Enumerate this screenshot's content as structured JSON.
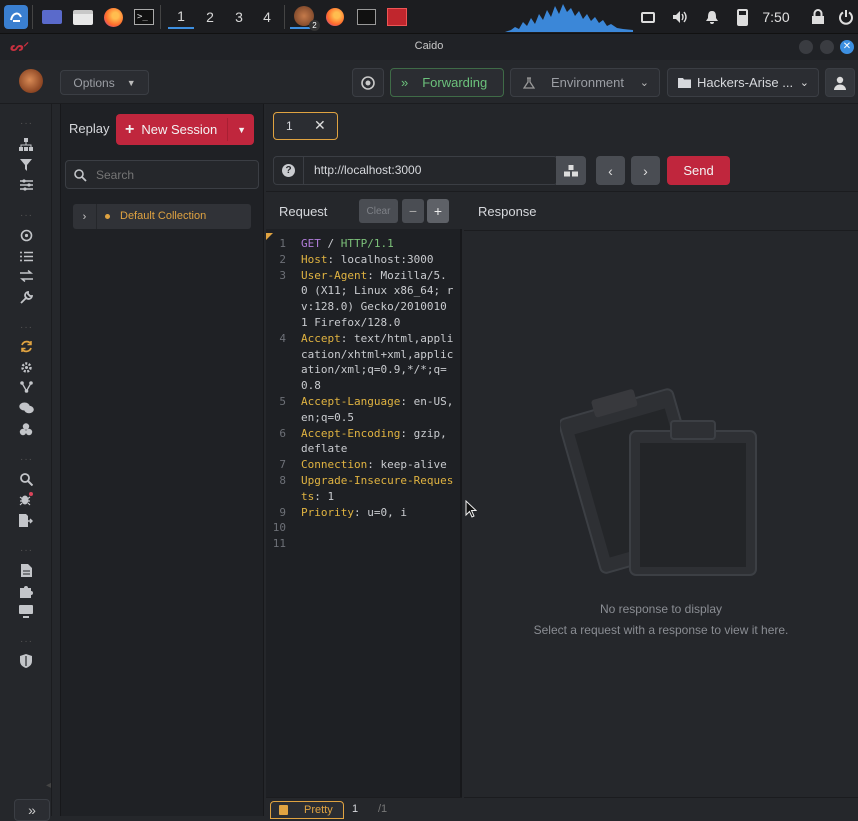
{
  "taskbar": {
    "workspaces": [
      "1",
      "2",
      "3",
      "4"
    ],
    "clock": "7:50",
    "app_badge": "2"
  },
  "app": {
    "title": "Caido"
  },
  "toolbar": {
    "options_label": "Options",
    "forwarding_label": "Forwarding",
    "environment_label": "Environment",
    "project_label": "Hackers-Arise ..."
  },
  "sidebar": {
    "title": "Replay",
    "new_session_label": "New Session",
    "search_placeholder": "Search",
    "collections": [
      {
        "label": "Default Collection"
      }
    ]
  },
  "tabs": [
    {
      "label": "1"
    }
  ],
  "request_bar": {
    "url": "http://localhost:3000",
    "send_label": "Send"
  },
  "request": {
    "title": "Request",
    "clear_label": "Clear",
    "lines": [
      {
        "n": "1",
        "parts": [
          {
            "t": "GET",
            "c": "m"
          },
          {
            "t": " / ",
            "c": ""
          },
          {
            "t": "HTTP/1.1",
            "c": "g"
          }
        ]
      },
      {
        "n": "2",
        "parts": [
          {
            "t": "Host",
            "c": "k"
          },
          {
            "t": ": localhost:3000",
            "c": ""
          }
        ]
      },
      {
        "n": "3",
        "parts": [
          {
            "t": "User-Agent",
            "c": "k"
          },
          {
            "t": ": Mozilla/5.\n0 (X11; Linux x86_64; r\nv:128.0) Gecko/2010010\n1 Firefox/128.0",
            "c": ""
          }
        ]
      },
      {
        "n": "4",
        "parts": [
          {
            "t": "Accept",
            "c": "k"
          },
          {
            "t": ": text/html,appli\ncation/xhtml+xml,applic\nation/xml;q=0.9,*/*;q=\n0.8",
            "c": ""
          }
        ]
      },
      {
        "n": "5",
        "parts": [
          {
            "t": "Accept-Language",
            "c": "k"
          },
          {
            "t": ": en-US,\nen;q=0.5",
            "c": ""
          }
        ]
      },
      {
        "n": "6",
        "parts": [
          {
            "t": "Accept-Encoding",
            "c": "k"
          },
          {
            "t": ": gzip,\ndeflate",
            "c": ""
          }
        ]
      },
      {
        "n": "7",
        "parts": [
          {
            "t": "Connection",
            "c": "k"
          },
          {
            "t": ": keep-alive",
            "c": ""
          }
        ]
      },
      {
        "n": "8",
        "parts": [
          {
            "t": "Upgrade-Insecure-Reques\nts",
            "c": "k"
          },
          {
            "t": ": 1",
            "c": ""
          }
        ]
      },
      {
        "n": "9",
        "parts": [
          {
            "t": "Priority",
            "c": "k"
          },
          {
            "t": ": u=0, i",
            "c": ""
          }
        ]
      },
      {
        "n": "10",
        "parts": []
      },
      {
        "n": "11",
        "parts": []
      }
    ],
    "footer_mode_label": "Pretty",
    "footer_page": "1",
    "footer_total": "/1"
  },
  "response": {
    "title": "Response",
    "empty_title": "No response to display",
    "empty_hint": "Select a request with a response to view it here."
  },
  "colors": {
    "accent_red": "#c0263d",
    "forwarding_green": "#59b86a",
    "collection_dot": "#e0a341"
  },
  "icons": [
    "caido-logo-icon",
    "sitemap-icon",
    "filter-icon",
    "sliders-icon",
    "crosshair-icon",
    "list-icon",
    "swap-icon",
    "wrench-icon",
    "replay-icon",
    "automate-icon",
    "workflow-icon",
    "chat-icon",
    "plugins-icon",
    "search-icon",
    "bug-icon",
    "export-icon",
    "file-icon",
    "puzzle-icon",
    "monitor-icon",
    "shield-icon",
    "expand-icon"
  ]
}
